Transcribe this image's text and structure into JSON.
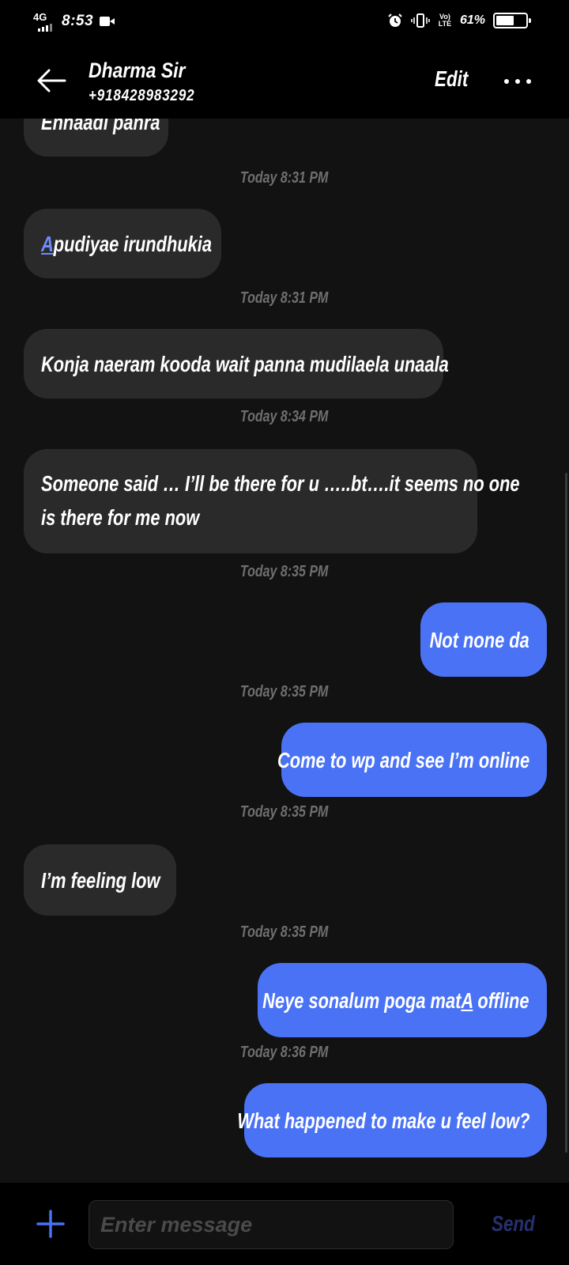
{
  "status_bar": {
    "network": "4G",
    "time": "8:53",
    "volte": "Vo) LTE",
    "battery_percent_label": "61%",
    "battery_level": 0.61
  },
  "header": {
    "contact_name": "Dharma Sir",
    "contact_number": "+918428983292",
    "edit_label": "Edit"
  },
  "messages": [
    {
      "type": "in",
      "text": "Enhaadi panra"
    },
    {
      "type": "ts",
      "text": "Today 8:31 PM"
    },
    {
      "type": "in",
      "text_first": "A",
      "text_rest": "pudiyae irundhukia"
    },
    {
      "type": "ts",
      "text": "Today 8:31 PM"
    },
    {
      "type": "in",
      "text": "Konja naeram kooda wait panna mudilaela unaala"
    },
    {
      "type": "ts",
      "text": "Today 8:34 PM"
    },
    {
      "type": "in",
      "line1": "Someone said … I’ll be there for u …..bt….it seems no one",
      "line2": "is there for me now"
    },
    {
      "type": "ts",
      "text": "Today 8:35 PM"
    },
    {
      "type": "out",
      "text": "Not none da"
    },
    {
      "type": "ts",
      "text": "Today 8:35 PM"
    },
    {
      "type": "out",
      "text": "Come to wp and see I’m online"
    },
    {
      "type": "ts",
      "text": "Today 8:35 PM"
    },
    {
      "type": "in",
      "text": "I’m feeling low"
    },
    {
      "type": "ts",
      "text": "Today 8:35 PM"
    },
    {
      "type": "out",
      "text_before": "Neye sonalum poga mat",
      "text_ul": "A",
      "text_after": " offline"
    },
    {
      "type": "ts",
      "text": "Today 8:36 PM"
    },
    {
      "type": "out",
      "text": "What happened to make u feel low?"
    }
  ],
  "composer": {
    "placeholder": "Enter message",
    "send_label": "Send"
  },
  "colors": {
    "background": "#121212",
    "incoming_bubble": "#2a2a2a",
    "outgoing_bubble": "#4a72f5",
    "timestamp": "#6f6f6f",
    "send_disabled": "#26306e",
    "accent": "#4a72f5"
  },
  "icons": [
    "back-arrow-icon",
    "more-dots-icon",
    "plus-icon",
    "alarm-icon",
    "vibrate-icon",
    "battery-icon",
    "video-icon",
    "signal-icon"
  ]
}
